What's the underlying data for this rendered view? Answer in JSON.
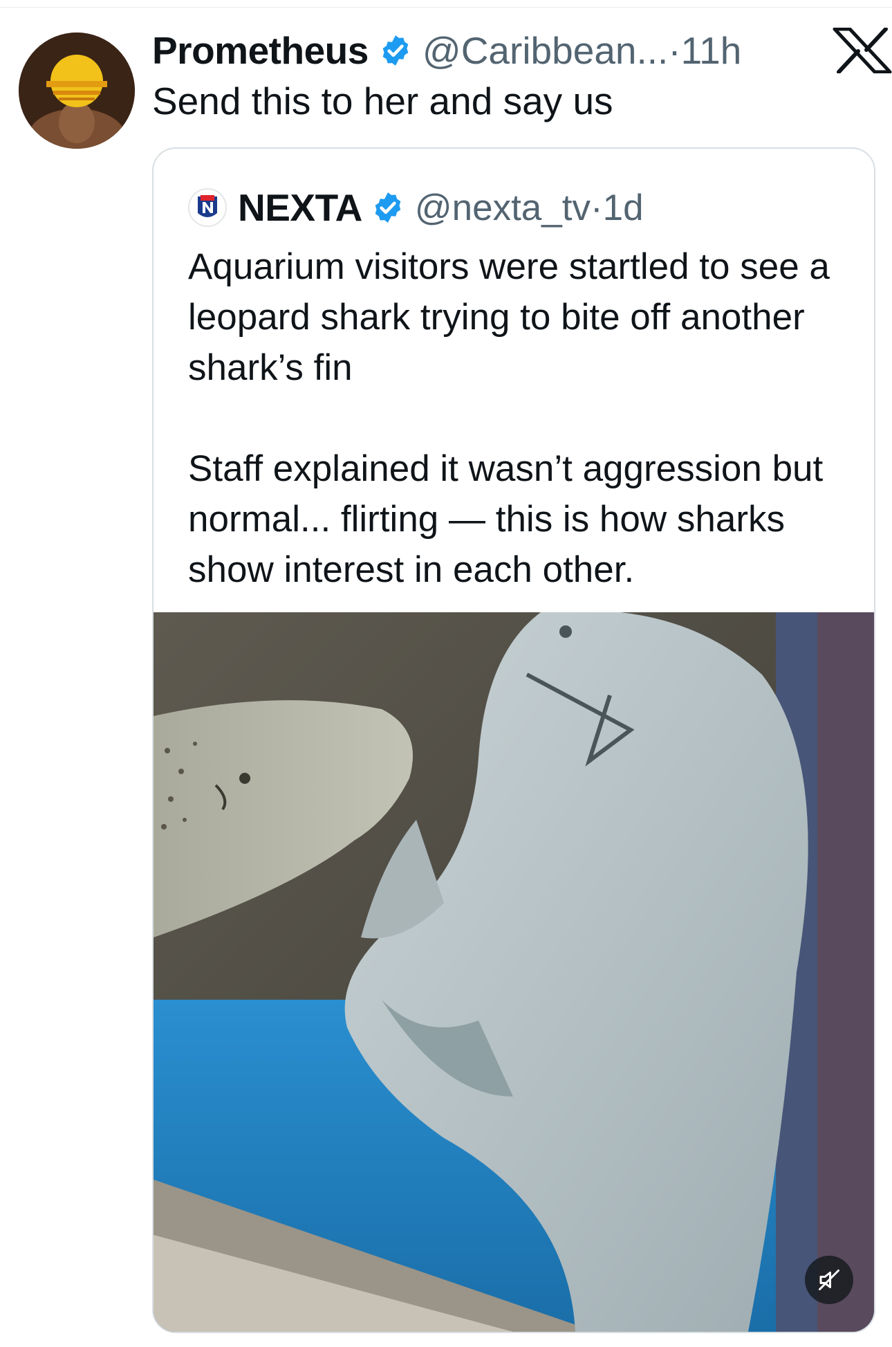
{
  "post": {
    "author_name": "Prometheus",
    "handle_time": "@Caribbean...·11h",
    "text": "Send this to her and say us"
  },
  "quoted": {
    "author_name": "NEXTA",
    "handle_time": "@nexta_tv·1d",
    "text": "Aquarium visitors were startled to see a leopard shark trying to bite off another shark’s fin\n\nStaff explained it wasn’t aggression but normal... flirting — this is how sharks show interest in each other."
  },
  "icons": {
    "avatar": "sunset-avatar",
    "verified": "verified-badge-icon",
    "platform": "x-logo-icon",
    "media_control": "mute-icon"
  },
  "colors": {
    "verified": "#1d9bf0",
    "secondary_text": "#536471",
    "primary_text": "#0f1419"
  }
}
